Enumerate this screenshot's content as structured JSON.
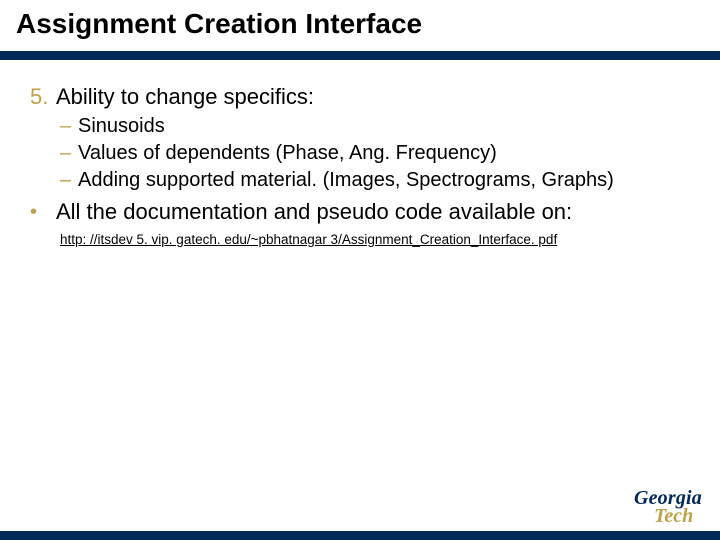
{
  "colors": {
    "brand_navy": "#002957",
    "brand_gold": "#BFA14A"
  },
  "title": "Assignment Creation Interface",
  "items": [
    {
      "marker": "5.",
      "text": "Ability to change specifics:",
      "sub": [
        "Sinusoids",
        "Values of dependents (Phase, Ang. Frequency)",
        "Adding supported material. (Images, Spectrograms, Graphs)"
      ]
    },
    {
      "marker": "•",
      "text": "All the documentation and pseudo code available on:"
    }
  ],
  "link_text": "http: //itsdev 5. vip. gatech. edu/~pbhatnagar 3/Assignment_Creation_Interface. pdf",
  "logo": {
    "line1": "Georgia",
    "line2": "Tech"
  }
}
